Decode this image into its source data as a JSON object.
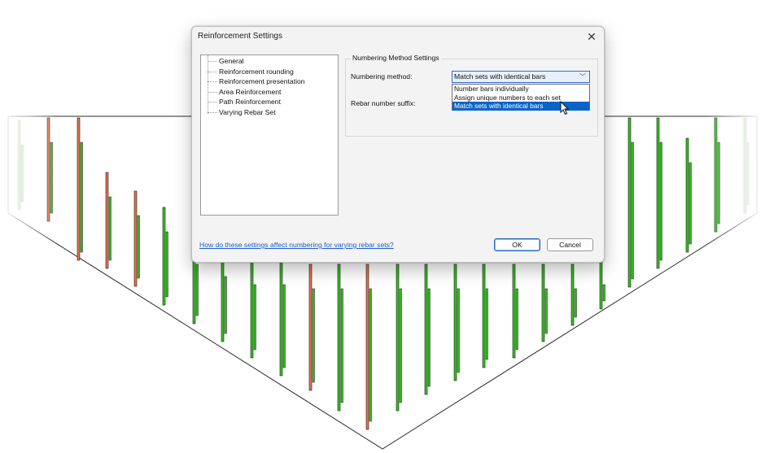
{
  "dialog": {
    "title": "Reinforcement Settings",
    "close_symbol": "✕",
    "tree_items": [
      {
        "label": "General"
      },
      {
        "label": "Reinforcement rounding"
      },
      {
        "label": "Reinforcement presentation"
      },
      {
        "label": "Area Reinforcement"
      },
      {
        "label": "Path Reinforcement"
      },
      {
        "label": "Varying Rebar Set"
      }
    ],
    "group_title": "Numbering Method Settings",
    "numbering_method_label": "Numbering method:",
    "numbering_method_value": "Match sets with identical bars",
    "dropdown_options": [
      {
        "label": "Number bars individually",
        "selected": false
      },
      {
        "label": "Assign unique numbers to each set",
        "selected": false
      },
      {
        "label": "Match sets with identical bars",
        "selected": true
      }
    ],
    "suffix_label": "Rebar number suffix:",
    "help_link": "How do these settings affect numbering for varying rebar sets?",
    "ok_label": "OK",
    "cancel_label": "Cancel"
  },
  "colors": {
    "bar_orange": "#e8734a",
    "bar_green": "#35c21f",
    "selection_blue": "#0a64c8",
    "link_blue": "#1a5cd6"
  },
  "icons": [
    "close-icon",
    "chevron-down-icon",
    "mouse-pointer-icon"
  ]
}
